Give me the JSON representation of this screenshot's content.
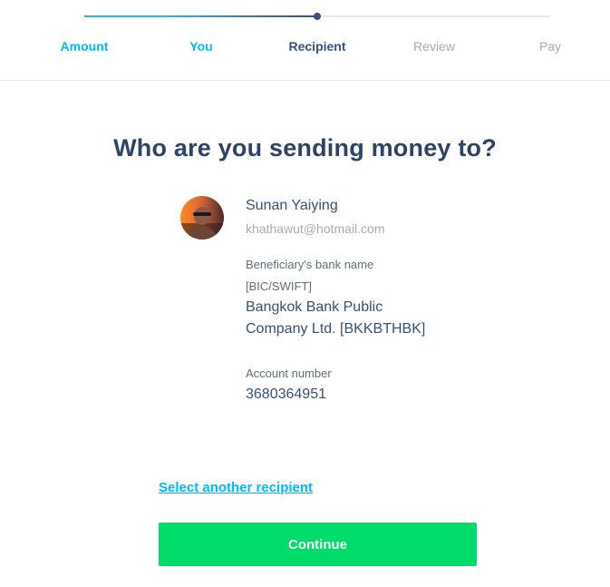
{
  "stepper": {
    "steps": [
      {
        "label": "Amount",
        "state": "done"
      },
      {
        "label": "You",
        "state": "done"
      },
      {
        "label": "Recipient",
        "state": "active"
      },
      {
        "label": "Review",
        "state": "todo"
      },
      {
        "label": "Pay",
        "state": "todo"
      }
    ],
    "progress": 0.5
  },
  "page": {
    "title": "Who are you sending money to?"
  },
  "recipient": {
    "avatar_icon": "user-photo-avatar",
    "name": "Sunan Yaiying",
    "email": "khathawut@hotmail.com",
    "bank_label_line1": "Beneficiary's bank name",
    "bank_label_line2": "[BIC/SWIFT]",
    "bank_value_line1": "Bangkok Bank Public",
    "bank_value_line2": "Company Ltd. [BKKBTHBK]",
    "account_label": "Account number",
    "account_value": "3680364951"
  },
  "actions": {
    "select_another": "Select another recipient",
    "continue": "Continue"
  },
  "colors": {
    "brand_navy": "#37517e",
    "brand_blue": "#00b9ff",
    "brand_green": "#00dc6a",
    "muted": "#a8aaac"
  }
}
